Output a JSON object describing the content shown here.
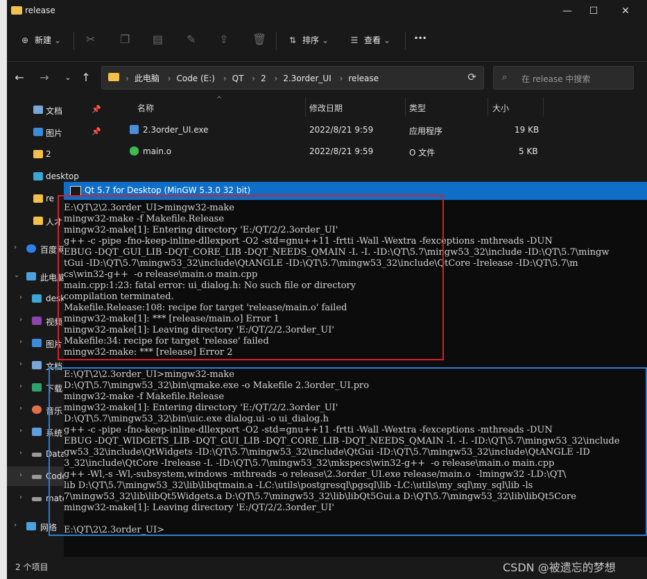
{
  "window": {
    "title": "release",
    "minimize": "—",
    "maximize": "☐",
    "close": "✕"
  },
  "toolbar": {
    "new_label": "新建",
    "sort_label": "排序",
    "view_label": "查看",
    "more": "···"
  },
  "address": {
    "crumbs": [
      "此电脑",
      "Code (E:)",
      "QT",
      "2",
      "2.3order_UI",
      "release"
    ]
  },
  "search": {
    "placeholder": "在 release 中搜索"
  },
  "sidebar": {
    "items": [
      {
        "label": "文档",
        "pinned": true
      },
      {
        "label": "图片",
        "pinned": true
      },
      {
        "label": "2"
      },
      {
        "label": "desktop"
      },
      {
        "label": "re"
      },
      {
        "label": "人才"
      },
      {
        "label": "百度网"
      },
      {
        "label": "此电脑"
      },
      {
        "label": "deskt"
      },
      {
        "label": "视频"
      },
      {
        "label": "图片"
      },
      {
        "label": "文档"
      },
      {
        "label": "下载"
      },
      {
        "label": "音乐"
      },
      {
        "label": "系统"
      },
      {
        "label": "Data"
      },
      {
        "label": "Code"
      },
      {
        "label": "mate"
      },
      {
        "label": "网络"
      }
    ]
  },
  "columns": {
    "name": "名称",
    "date": "修改日期",
    "type": "类型",
    "size": "大小"
  },
  "files": [
    {
      "name": "2.3order_UI.exe",
      "date": "2022/8/21 9:59",
      "type": "应用程序",
      "size": "19 KB"
    },
    {
      "name": "main.o",
      "date": "2022/8/21 9:59",
      "type": "O 文件",
      "size": "5 KB"
    }
  ],
  "status": {
    "count": "2 个项目"
  },
  "cmd": {
    "title": "Qt 5.7 for Desktop (MinGW 5.3.0 32 bit)",
    "lines": [
      "E:\\QT\\2\\2.3order_UI>mingw32-make",
      "mingw32-make -f Makefile.Release",
      "mingw32-make[1]: Entering directory 'E:/QT/2/2.3order_UI'",
      "g++ -c -pipe -fno-keep-inline-dllexport -O2 -std=gnu++11 -frtti -Wall -Wextra -fexceptions -mthreads -DUN",
      "EBUG -DQT_GUI_LIB -DQT_CORE_LIB -DQT_NEEDS_QMAIN -I. -I. -ID:\\QT\\5.7\\mingw53_32\\include -ID:\\QT\\5.7\\mingw",
      "tGui -ID:\\QT\\5.7\\mingw53_32\\include\\QtANGLE -ID:\\QT\\5.7\\mingw53_32\\include\\QtCore -Irelease -ID:\\QT\\5.7\\m",
      "cs\\win32-g++  -o release\\main.o main.cpp",
      "main.cpp:1:23: fatal error: ui_dialog.h: No such file or directory",
      "compilation terminated.",
      "Makefile.Release:108: recipe for target 'release/main.o' failed",
      "mingw32-make[1]: *** [release/main.o] Error 1",
      "mingw32-make[1]: Leaving directory 'E:/QT/2/2.3order_UI'",
      "Makefile:34: recipe for target 'release' failed",
      "mingw32-make: *** [release] Error 2",
      "",
      "E:\\QT\\2\\2.3order_UI>mingw32-make",
      "D:\\QT\\5.7\\mingw53_32\\bin\\qmake.exe -o Makefile 2.3order_UI.pro",
      "mingw32-make -f Makefile.Release",
      "mingw32-make[1]: Entering directory 'E:/QT/2/2.3order_UI'",
      "D:\\QT\\5.7\\mingw53_32\\bin\\uic.exe dialog.ui -o ui_dialog.h",
      "g++ -c -pipe -fno-keep-inline-dllexport -O2 -std=gnu++11 -frtti -Wall -Wextra -fexceptions -mthreads -DUN",
      "EBUG -DQT_WIDGETS_LIB -DQT_GUI_LIB -DQT_CORE_LIB -DQT_NEEDS_QMAIN -I. -I. -ID:\\QT\\5.7\\mingw53_32\\include",
      "gw53_32\\include\\QtWidgets -ID:\\QT\\5.7\\mingw53_32\\include\\QtGui -ID:\\QT\\5.7\\mingw53_32\\include\\QtANGLE -ID",
      "3_32\\include\\QtCore -Irelease -I. -ID:\\QT\\5.7\\mingw53_32\\mkspecs\\win32-g++  -o release\\main.o main.cpp",
      "g++ -Wl,-s -Wl,-subsystem,windows -mthreads -o release\\2.3order_UI.exe release/main.o  -lmingw32 -LD:\\QT\\",
      "lib D:\\QT\\5.7\\mingw53_32\\lib\\libqtmain.a -LC:\\utils\\postgresql\\pgsql\\lib -LC:\\utils\\my_sql\\my_sql\\lib -ls",
      "7\\mingw53_32\\lib\\libQt5Widgets.a D:\\QT\\5.7\\mingw53_32\\lib\\libQt5Gui.a D:\\QT\\5.7\\mingw53_32\\lib\\libQt5Core",
      "mingw32-make[1]: Leaving directory 'E:/QT/2/2.3order_UI'",
      "",
      "E:\\QT\\2\\2.3order_UI>"
    ]
  },
  "watermark": "CSDN @被遗忘的梦想",
  "colors": {
    "folder": "#f3c04b",
    "cmd_title": "#0f6fc6",
    "red_highlight": "#d81e2c",
    "blue_highlight": "#2d7fd6"
  }
}
